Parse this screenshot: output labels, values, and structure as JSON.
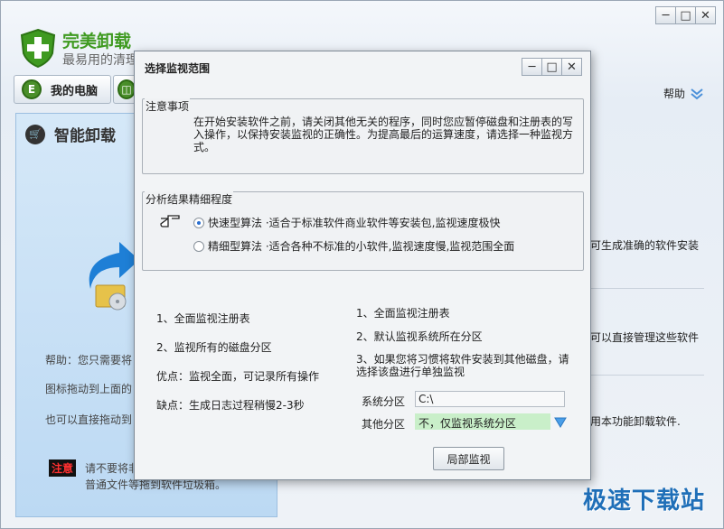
{
  "main_window": {
    "app_name": "完美卸载",
    "app_slogan": "最易用的清理",
    "nav": {
      "my_computer_label": "我的电脑",
      "my_computer_icon": "E",
      "second_icon": "◫"
    },
    "help_label": "帮助",
    "panel_title": "智能卸载",
    "left_panel": {
      "help_line1": "帮助：您只需要将",
      "help_line2": "图标拖动到上面的",
      "help_line3": "也可以直接拖动到",
      "warn_tag": "注意",
      "warn_line1": "请不要将非",
      "warn_line2": "普通文件等拖到软件垃圾箱。"
    },
    "right_panel": {
      "line1": "可生成准确的软件安装",
      "line2": "可以直接管理这些软件",
      "line3": "用本功能卸载软件."
    },
    "watermark": "极速下载站"
  },
  "dialog": {
    "title": "选择监视范围",
    "notice": {
      "label": "注意事项",
      "text": "在开始安装软件之前，请关闭其他无关的程序，同时您应暂停磁盘和注册表的写入操作，以保持安装监视的正确性。为提高最后的运算速度，请选择一种监视方式。"
    },
    "analysis": {
      "label": "分析结果精细程度",
      "options": [
        {
          "label": "快速型算法 ·适合于标准软件商业软件等安装包,监视速度极快",
          "selected": true
        },
        {
          "label": "精细型算法 ·适合各种不标准的小软件,监视速度慢,监视范围全面",
          "selected": false
        }
      ]
    },
    "full_monitor": {
      "item1": "1、全面监视注册表",
      "item2": "2、监视所有的磁盘分区",
      "pros": "优点：监视全面，可记录所有操作",
      "cons": "缺点：生成日志过程稍慢2-3秒"
    },
    "partial_monitor": {
      "item1": "1、全面监视注册表",
      "item2": "2、默认监视系统所在分区",
      "item3_line1": "3、如果您将习惯将软件安装到其他磁盘，请",
      "item3_line2": "选择该盘进行单独监视"
    },
    "system_partition": {
      "label": "系统分区",
      "value": "C:\\"
    },
    "other_partition": {
      "label": "其他分区",
      "value": "不，仅监视系统分区"
    },
    "button_label": "局部监视",
    "controls": {
      "minimize": "─",
      "maximize": "□",
      "close": "✕"
    }
  },
  "colors": {
    "accent_green": "#3f9a20",
    "selection_green": "#c9efc9",
    "watermark_blue": "#1f6fb8",
    "panel_blue": "#bcd9f3"
  }
}
